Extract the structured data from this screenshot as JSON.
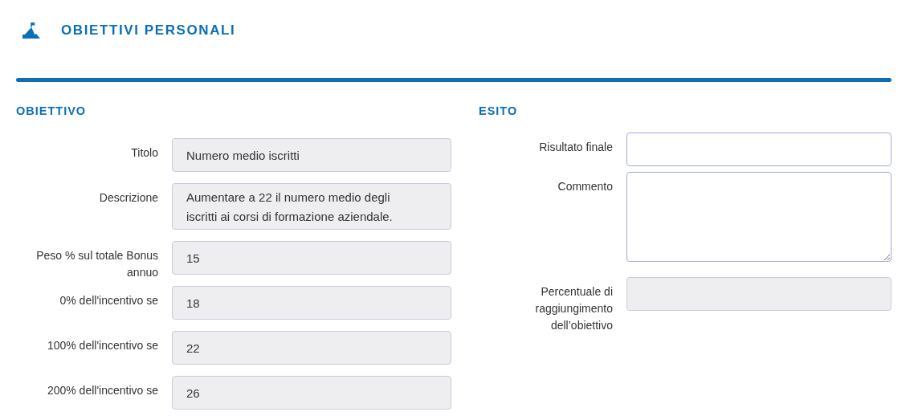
{
  "header": {
    "title": "OBIETTIVI PERSONALI"
  },
  "sections": [
    {
      "title": "OBIETTIVO",
      "fields": [
        {
          "label": "Titolo",
          "kind": "single",
          "readonly": true,
          "value": "Numero medio iscritti"
        },
        {
          "label": "Descrizione",
          "kind": "multi",
          "readonly": true,
          "value": "Aumentare a 22 il numero medio degli iscritti ai corsi di formazione aziendale."
        },
        {
          "label": "Peso % sul totale Bonus annuo",
          "kind": "single",
          "readonly": true,
          "value": "15"
        },
        {
          "label": "0% dell'incentivo se",
          "kind": "single",
          "readonly": true,
          "value": "18"
        },
        {
          "label": "100% dell'incentivo se",
          "kind": "single",
          "readonly": true,
          "value": "22"
        },
        {
          "label": "200% dell'incentivo se",
          "kind": "single",
          "readonly": true,
          "value": "26"
        }
      ]
    },
    {
      "title": "ESITO",
      "fields": [
        {
          "label": "Risultato finale",
          "kind": "single",
          "readonly": false
        },
        {
          "label": "Commento",
          "kind": "area",
          "readonly": false
        },
        {
          "label": "Percentuale di raggiungimento dell’obiettivo",
          "kind": "single",
          "readonly": true
        }
      ]
    }
  ]
}
